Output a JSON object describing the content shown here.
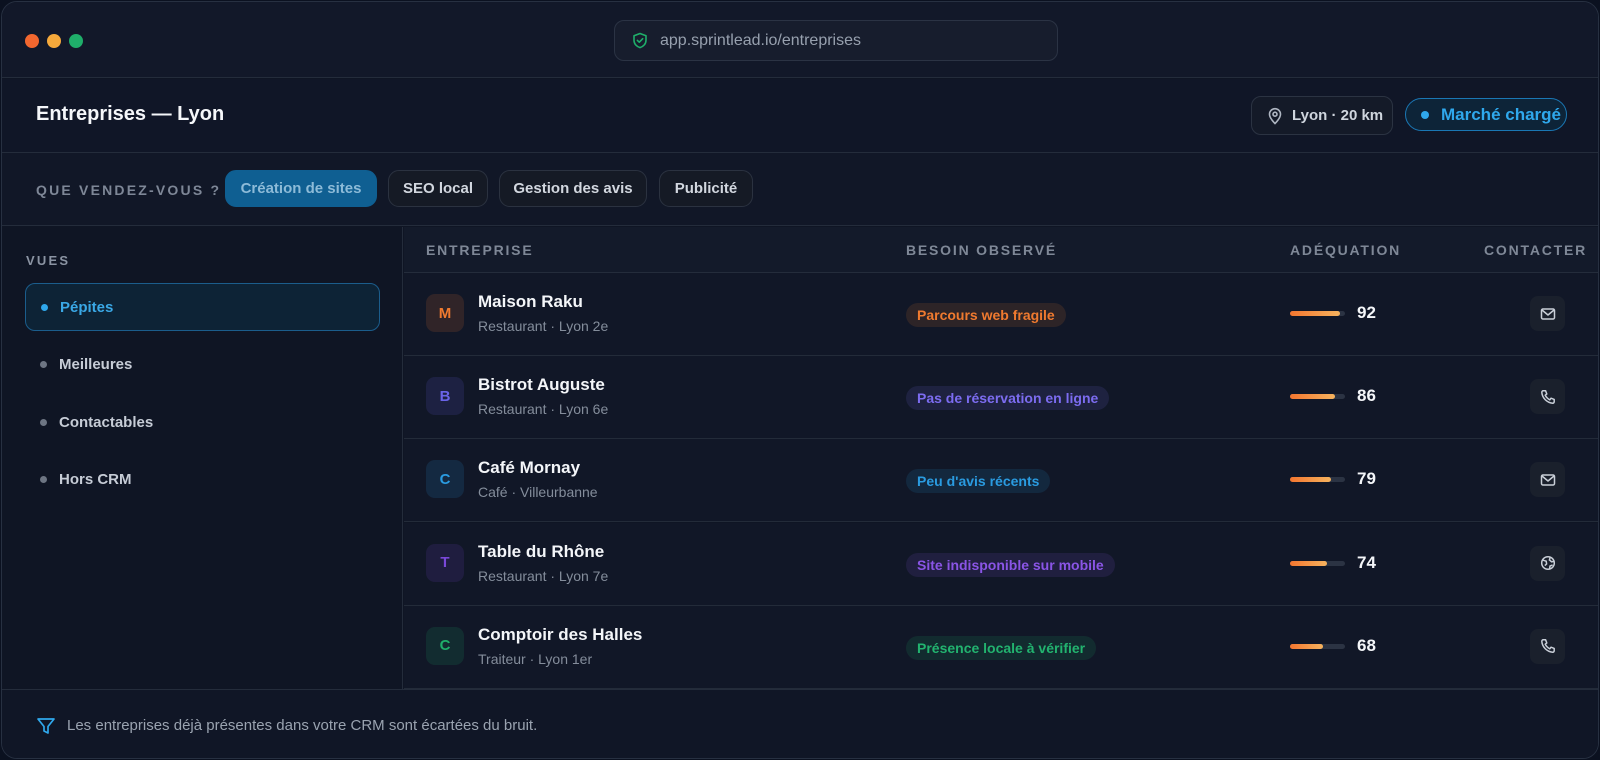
{
  "browser": {
    "url": "app.sprintlead.io/entreprises"
  },
  "header": {
    "title": "Entreprises — Lyon",
    "location": "Lyon · 20 km",
    "market_status": "Marché chargé"
  },
  "filters": {
    "label": "QUE VENDEZ-VOUS ?",
    "options": [
      "Création de sites",
      "SEO local",
      "Gestion des avis",
      "Publicité"
    ],
    "selected": "Création de sites"
  },
  "sidebar": {
    "heading": "VUES",
    "items": [
      {
        "label": "Pépites",
        "active": true
      },
      {
        "label": "Meilleures",
        "active": false
      },
      {
        "label": "Contactables",
        "active": false
      },
      {
        "label": "Hors CRM",
        "active": false
      }
    ]
  },
  "table": {
    "columns": [
      "ENTREPRISE",
      "BESOIN OBSERVÉ",
      "ADÉQUATION",
      "CONTACTER"
    ],
    "rows": [
      {
        "initial": "M",
        "name": "Maison Raku",
        "subtitle": "Restaurant · Lyon 2e",
        "need": "Parcours web fragile",
        "score": 92,
        "contact_icon": "mail-icon",
        "avatar_color": "#f07a2f",
        "need_color": "#f07a2f"
      },
      {
        "initial": "B",
        "name": "Bistrot Auguste",
        "subtitle": "Restaurant · Lyon 6e",
        "need": "Pas de réservation en ligne",
        "score": 86,
        "contact_icon": "phone-icon",
        "avatar_color": "#6a64e8",
        "need_color": "#7c6cf0"
      },
      {
        "initial": "C",
        "name": "Café Mornay",
        "subtitle": "Café · Villeurbanne",
        "need": "Peu d'avis récents",
        "score": 79,
        "contact_icon": "mail-icon",
        "avatar_color": "#2a9be0",
        "need_color": "#2a9be0"
      },
      {
        "initial": "T",
        "name": "Table du Rhône",
        "subtitle": "Restaurant · Lyon 7e",
        "need": "Site indisponible sur mobile",
        "score": 74,
        "contact_icon": "globe-icon",
        "avatar_color": "#7a48d8",
        "need_color": "#8a55e6"
      },
      {
        "initial": "C",
        "name": "Comptoir des Halles",
        "subtitle": "Traiteur · Lyon 1er",
        "need": "Présence locale à vérifier",
        "score": 68,
        "contact_icon": "phone-icon",
        "avatar_color": "#1fae6a",
        "need_color": "#22b36f"
      }
    ]
  },
  "footer": {
    "note": "Les entreprises déjà présentes dans votre CRM sont écartées du bruit."
  }
}
